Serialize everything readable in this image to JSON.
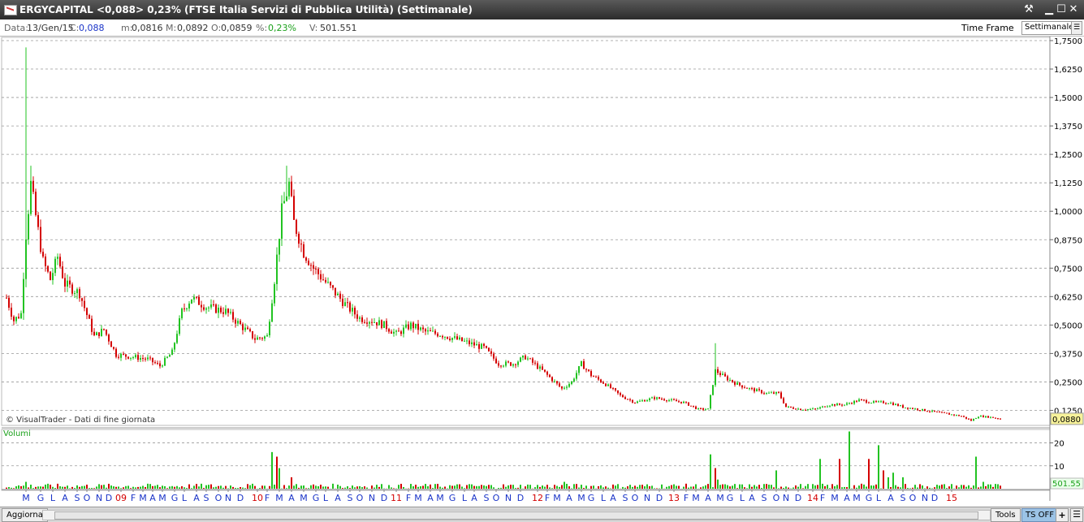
{
  "window": {
    "title": "ERGYCAPITAL <0,088> 0,23%  (FTSE Italia Servizi di Pubblica Utilità)  (Settimanale)"
  },
  "infobar": {
    "data_label": "Data:",
    "data_value": "13/Gen/15",
    "close_label": "C:",
    "close_value": "0,088",
    "min_label": "m:",
    "min_value": "0,0816",
    "max_label": "M:",
    "max_value": "0,0892",
    "open_label": "O:",
    "open_value": "0,0859",
    "pct_label": "%:",
    "pct_value": "0,23%",
    "vol_label": "V:",
    "vol_value": "501.551",
    "time_frame_label": "Time Frame",
    "time_frame_value": "Settimanale"
  },
  "bottombar": {
    "refresh_label": "Aggiorna",
    "tools_label": "Tools",
    "ts_label": "TS OFF",
    "plus_label": "+"
  },
  "colors": {
    "up": "#22c322",
    "down": "#d40000",
    "volume": "#22c322",
    "accent_last": "#f7f29a"
  },
  "chart_data": [
    {
      "type": "candlestick",
      "name": "price",
      "watermark": "© VisualTrader - Dati di fine giornata",
      "last_value_label": "0,0880",
      "last_value": 0.088,
      "ylim": [
        0.0625,
        1.75
      ],
      "y_ticks": [
        "1,7500",
        "1,6250",
        "1,5000",
        "1,3750",
        "1,2500",
        "1,1250",
        "1,0000",
        "0,8750",
        "0,7500",
        "0,6250",
        "0,5000",
        "0,3750",
        "0,2500",
        "0,1250"
      ],
      "y_tick_values": [
        1.75,
        1.625,
        1.5,
        1.375,
        1.25,
        1.125,
        1.0,
        0.875,
        0.75,
        0.625,
        0.5,
        0.375,
        0.25,
        0.125
      ],
      "anchors": [
        [
          0,
          0.62
        ],
        [
          3,
          0.52
        ],
        [
          6,
          0.55
        ],
        [
          8,
          0.9
        ],
        [
          10,
          1.12
        ],
        [
          12,
          0.98
        ],
        [
          15,
          0.78
        ],
        [
          18,
          0.7
        ],
        [
          21,
          0.8
        ],
        [
          24,
          0.68
        ],
        [
          30,
          0.64
        ],
        [
          36,
          0.45
        ],
        [
          40,
          0.48
        ],
        [
          45,
          0.37
        ],
        [
          52,
          0.36
        ],
        [
          58,
          0.35
        ],
        [
          63,
          0.32
        ],
        [
          68,
          0.38
        ],
        [
          72,
          0.56
        ],
        [
          76,
          0.62
        ],
        [
          82,
          0.58
        ],
        [
          90,
          0.56
        ],
        [
          96,
          0.5
        ],
        [
          102,
          0.44
        ],
        [
          107,
          0.45
        ],
        [
          110,
          0.7
        ],
        [
          113,
          1.0
        ],
        [
          116,
          1.12
        ],
        [
          118,
          0.95
        ],
        [
          122,
          0.82
        ],
        [
          126,
          0.75
        ],
        [
          130,
          0.7
        ],
        [
          135,
          0.64
        ],
        [
          140,
          0.58
        ],
        [
          145,
          0.53
        ],
        [
          150,
          0.52
        ],
        [
          155,
          0.5
        ],
        [
          160,
          0.46
        ],
        [
          166,
          0.5
        ],
        [
          172,
          0.47
        ],
        [
          178,
          0.46
        ],
        [
          184,
          0.44
        ],
        [
          190,
          0.42
        ],
        [
          196,
          0.4
        ],
        [
          202,
          0.33
        ],
        [
          208,
          0.33
        ],
        [
          213,
          0.36
        ],
        [
          220,
          0.3
        ],
        [
          228,
          0.22
        ],
        [
          232,
          0.25
        ],
        [
          236,
          0.33
        ],
        [
          240,
          0.28
        ],
        [
          246,
          0.24
        ],
        [
          252,
          0.19
        ],
        [
          258,
          0.16
        ],
        [
          262,
          0.17
        ],
        [
          266,
          0.18
        ],
        [
          272,
          0.17
        ],
        [
          278,
          0.16
        ],
        [
          284,
          0.13
        ],
        [
          288,
          0.13
        ],
        [
          291,
          0.3
        ],
        [
          295,
          0.27
        ],
        [
          300,
          0.24
        ],
        [
          305,
          0.22
        ],
        [
          312,
          0.2
        ],
        [
          317,
          0.2
        ],
        [
          320,
          0.14
        ],
        [
          326,
          0.13
        ],
        [
          332,
          0.13
        ],
        [
          338,
          0.15
        ],
        [
          344,
          0.15
        ],
        [
          350,
          0.17
        ],
        [
          356,
          0.16
        ],
        [
          362,
          0.16
        ],
        [
          368,
          0.14
        ],
        [
          374,
          0.13
        ],
        [
          380,
          0.12
        ],
        [
          386,
          0.11
        ],
        [
          392,
          0.1
        ],
        [
          396,
          0.08
        ],
        [
          399,
          0.1
        ],
        [
          404,
          0.095
        ],
        [
          408,
          0.088
        ]
      ],
      "spikes": [
        [
          8,
          1.72
        ],
        [
          10,
          1.2
        ],
        [
          115,
          1.2
        ],
        [
          291,
          0.42
        ]
      ]
    },
    {
      "type": "bar",
      "name": "Volumi",
      "last_value_label": "501.55",
      "ylim": [
        0,
        28
      ],
      "y_ticks": [
        "20",
        "10"
      ],
      "y_tick_values": [
        20,
        10
      ],
      "peaks": [
        [
          8,
          3
        ],
        [
          109,
          16
        ],
        [
          111,
          14
        ],
        [
          112,
          9
        ],
        [
          117,
          5
        ],
        [
          229,
          3
        ],
        [
          289,
          15
        ],
        [
          291,
          9
        ],
        [
          292,
          4
        ],
        [
          316,
          8
        ],
        [
          334,
          13
        ],
        [
          342,
          13
        ],
        [
          346,
          25
        ],
        [
          354,
          13
        ],
        [
          358,
          19
        ],
        [
          360,
          8
        ],
        [
          362,
          5
        ],
        [
          364,
          7
        ],
        [
          368,
          5
        ],
        [
          398,
          14
        ],
        [
          401,
          3
        ]
      ]
    }
  ],
  "x_axis": {
    "labels": [
      {
        "text": "M",
        "i": 8,
        "year": false
      },
      {
        "text": "G",
        "i": 14,
        "year": false
      },
      {
        "text": "L",
        "i": 19,
        "year": false
      },
      {
        "text": "A",
        "i": 24,
        "year": false
      },
      {
        "text": "S",
        "i": 29,
        "year": false
      },
      {
        "text": "O",
        "i": 33,
        "year": false
      },
      {
        "text": "N",
        "i": 38,
        "year": false
      },
      {
        "text": "D",
        "i": 42,
        "year": false
      },
      {
        "text": "09",
        "i": 47,
        "year": true
      },
      {
        "text": "F",
        "i": 52,
        "year": false
      },
      {
        "text": "M",
        "i": 56,
        "year": false
      },
      {
        "text": "A",
        "i": 60,
        "year": false
      },
      {
        "text": "M",
        "i": 64,
        "year": false
      },
      {
        "text": "G",
        "i": 69,
        "year": false
      },
      {
        "text": "L",
        "i": 73,
        "year": false
      },
      {
        "text": "A",
        "i": 78,
        "year": false
      },
      {
        "text": "S",
        "i": 82,
        "year": false
      },
      {
        "text": "O",
        "i": 87,
        "year": false
      },
      {
        "text": "N",
        "i": 91,
        "year": false
      },
      {
        "text": "D",
        "i": 96,
        "year": false
      },
      {
        "text": "10",
        "i": 103,
        "year": true
      },
      {
        "text": "F",
        "i": 107,
        "year": false
      },
      {
        "text": "M",
        "i": 112,
        "year": false
      },
      {
        "text": "A",
        "i": 117,
        "year": false
      },
      {
        "text": "M",
        "i": 122,
        "year": false
      },
      {
        "text": "G",
        "i": 127,
        "year": false
      },
      {
        "text": "L",
        "i": 131,
        "year": false
      },
      {
        "text": "A",
        "i": 136,
        "year": false
      },
      {
        "text": "S",
        "i": 141,
        "year": false
      },
      {
        "text": "O",
        "i": 145,
        "year": false
      },
      {
        "text": "N",
        "i": 150,
        "year": false
      },
      {
        "text": "D",
        "i": 155,
        "year": false
      },
      {
        "text": "11",
        "i": 160,
        "year": true
      },
      {
        "text": "F",
        "i": 165,
        "year": false
      },
      {
        "text": "M",
        "i": 169,
        "year": false
      },
      {
        "text": "A",
        "i": 174,
        "year": false
      },
      {
        "text": "M",
        "i": 178,
        "year": false
      },
      {
        "text": "G",
        "i": 183,
        "year": false
      },
      {
        "text": "L",
        "i": 188,
        "year": false
      },
      {
        "text": "A",
        "i": 192,
        "year": false
      },
      {
        "text": "S",
        "i": 197,
        "year": false
      },
      {
        "text": "O",
        "i": 201,
        "year": false
      },
      {
        "text": "N",
        "i": 206,
        "year": false
      },
      {
        "text": "D",
        "i": 211,
        "year": false
      },
      {
        "text": "12",
        "i": 218,
        "year": true
      },
      {
        "text": "F",
        "i": 222,
        "year": false
      },
      {
        "text": "M",
        "i": 226,
        "year": false
      },
      {
        "text": "A",
        "i": 231,
        "year": false
      },
      {
        "text": "M",
        "i": 236,
        "year": false
      },
      {
        "text": "G",
        "i": 240,
        "year": false
      },
      {
        "text": "L",
        "i": 245,
        "year": false
      },
      {
        "text": "A",
        "i": 249,
        "year": false
      },
      {
        "text": "S",
        "i": 254,
        "year": false
      },
      {
        "text": "O",
        "i": 258,
        "year": false
      },
      {
        "text": "N",
        "i": 263,
        "year": false
      },
      {
        "text": "D",
        "i": 268,
        "year": false
      },
      {
        "text": "13",
        "i": 274,
        "year": true
      },
      {
        "text": "F",
        "i": 279,
        "year": false
      },
      {
        "text": "M",
        "i": 283,
        "year": false
      },
      {
        "text": "A",
        "i": 288,
        "year": false
      },
      {
        "text": "M",
        "i": 293,
        "year": false
      },
      {
        "text": "G",
        "i": 297,
        "year": false
      },
      {
        "text": "L",
        "i": 302,
        "year": false
      },
      {
        "text": "A",
        "i": 306,
        "year": false
      },
      {
        "text": "S",
        "i": 311,
        "year": false
      },
      {
        "text": "O",
        "i": 316,
        "year": false
      },
      {
        "text": "N",
        "i": 320,
        "year": false
      },
      {
        "text": "D",
        "i": 325,
        "year": false
      },
      {
        "text": "14",
        "i": 331,
        "year": true
      },
      {
        "text": "F",
        "i": 335,
        "year": false
      },
      {
        "text": "M",
        "i": 340,
        "year": false
      },
      {
        "text": "A",
        "i": 345,
        "year": false
      },
      {
        "text": "M",
        "i": 349,
        "year": false
      },
      {
        "text": "G",
        "i": 354,
        "year": false
      },
      {
        "text": "L",
        "i": 358,
        "year": false
      },
      {
        "text": "A",
        "i": 363,
        "year": false
      },
      {
        "text": "S",
        "i": 368,
        "year": false
      },
      {
        "text": "O",
        "i": 372,
        "year": false
      },
      {
        "text": "N",
        "i": 377,
        "year": false
      },
      {
        "text": "D",
        "i": 381,
        "year": false
      },
      {
        "text": "15",
        "i": 388,
        "year": true
      }
    ]
  }
}
